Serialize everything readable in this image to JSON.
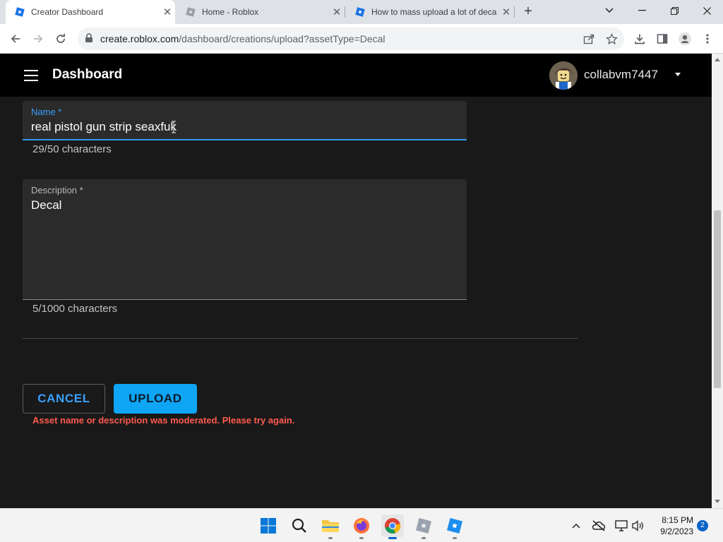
{
  "browser": {
    "tabs": [
      {
        "title": "Creator Dashboard",
        "active": true,
        "favicon": "roblox-icon"
      },
      {
        "title": "Home - Roblox",
        "active": false,
        "favicon": "roblox-icon"
      },
      {
        "title": "How to mass upload a lot of deca",
        "active": false,
        "favicon": "roblox-icon"
      }
    ],
    "url_host": "create.roblox.com",
    "url_path": "/dashboard/creations/upload?assetType=Decal"
  },
  "appbar": {
    "title": "Dashboard",
    "username": "collabvm7447"
  },
  "form": {
    "name_label": "Name *",
    "name_value": "real pistol gun strip seaxfuk",
    "name_counter": "29/50 characters",
    "description_label": "Description *",
    "description_value": "Decal",
    "description_counter": "5/1000 characters",
    "cancel_label": "CANCEL",
    "upload_label": "UPLOAD",
    "error_message": "Asset name or description was moderated. Please try again."
  },
  "taskbar": {
    "time": "8:15 PM",
    "date": "9/2/2023",
    "notification_count": "2"
  },
  "colors": {
    "accent": "#3aa0ff",
    "upload_button": "#0ea5f5",
    "error": "#ff5a4e",
    "page_bg": "#191919",
    "appbar_bg": "#000000"
  }
}
